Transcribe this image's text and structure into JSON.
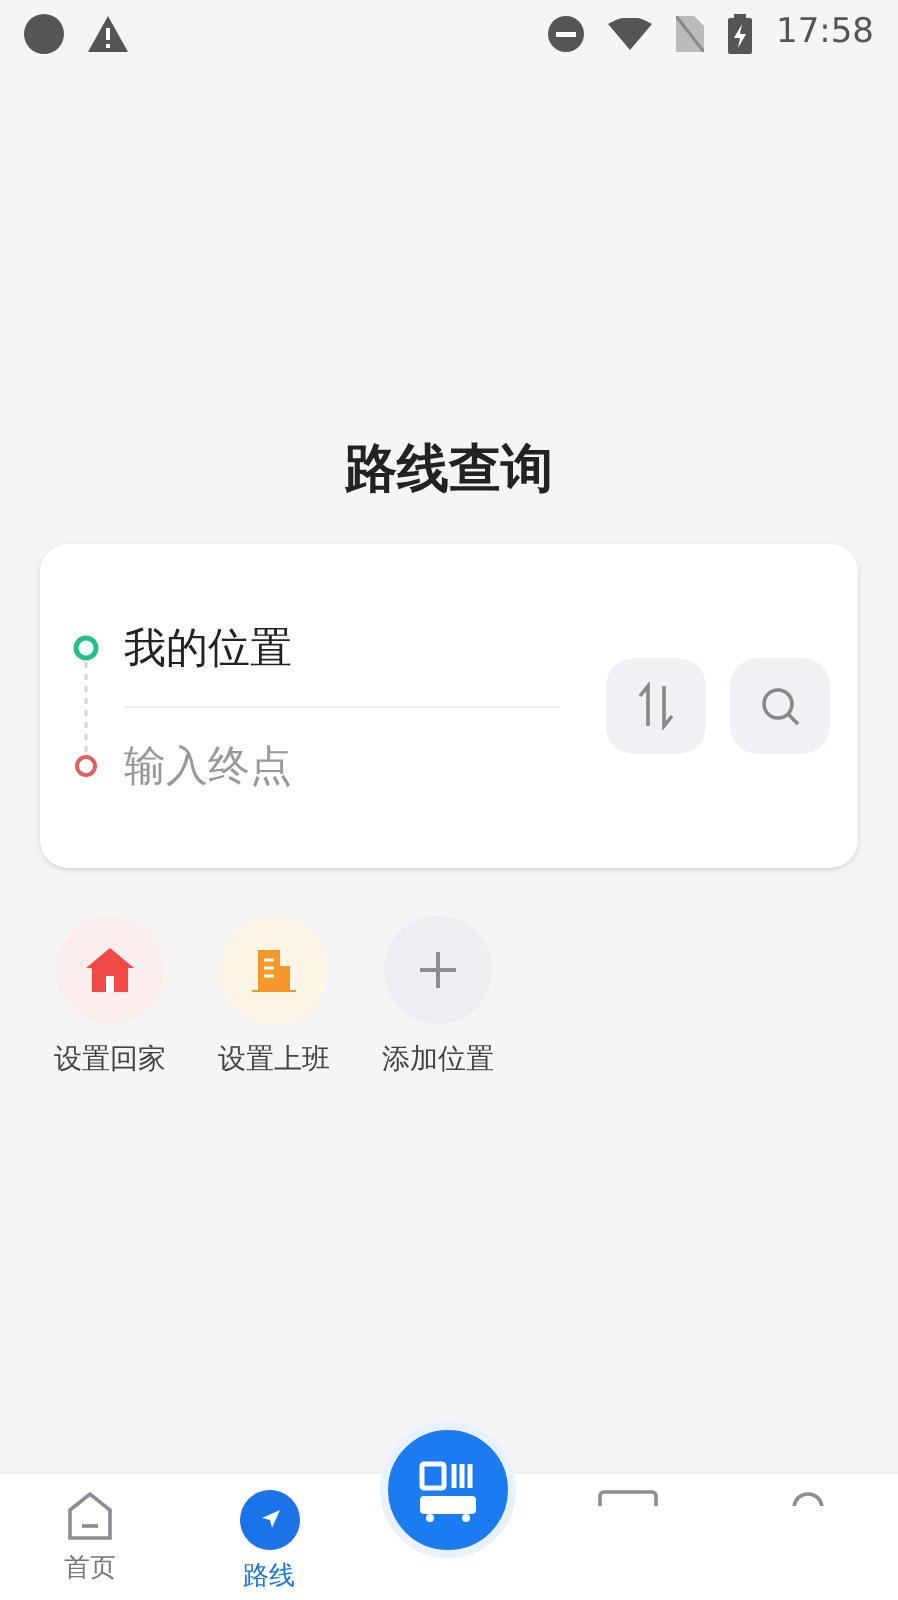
{
  "status_bar": {
    "time": "17:58"
  },
  "title": "路线查询",
  "route": {
    "origin": "我的位置",
    "destination_placeholder": "输入终点"
  },
  "shortcuts": [
    {
      "kind": "home",
      "label": "设置回家"
    },
    {
      "kind": "work",
      "label": "设置上班"
    },
    {
      "kind": "add",
      "label": "添加位置"
    }
  ],
  "tabs": [
    {
      "kind": "home",
      "label": "首页",
      "selected": false
    },
    {
      "kind": "route",
      "label": "路线",
      "selected": true
    },
    {
      "kind": "bus",
      "selected": false
    },
    {
      "kind": "card",
      "selected": false
    },
    {
      "kind": "person",
      "selected": false
    }
  ]
}
